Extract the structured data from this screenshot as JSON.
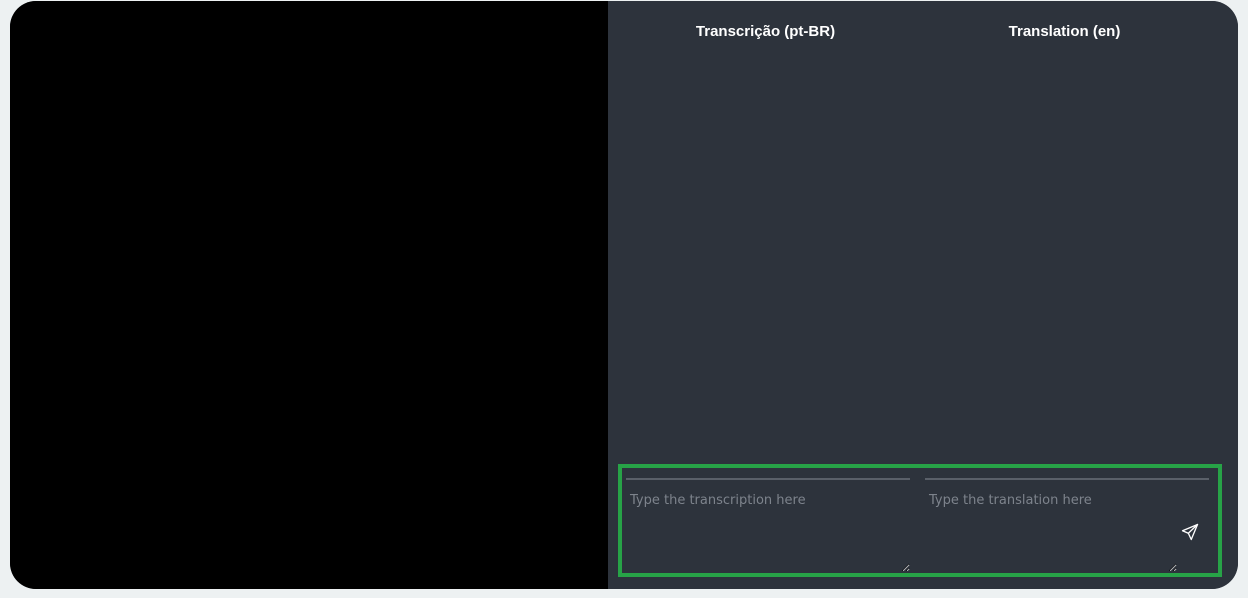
{
  "video": {},
  "columns": {
    "transcription_header": "Transcrição (pt-BR)",
    "translation_header": "Translation (en)"
  },
  "inputs": {
    "transcription_placeholder": "Type the transcription here",
    "transcription_value": "",
    "translation_placeholder": "Type the translation here",
    "translation_value": ""
  },
  "send": {
    "icon": "send-icon"
  },
  "colors": {
    "page_background": "#edf1f2",
    "panel_background": "#2d333c",
    "video_background": "#000000",
    "highlight_border": "#27a347",
    "header_text": "#ffffff",
    "placeholder_text": "#7d838c"
  }
}
